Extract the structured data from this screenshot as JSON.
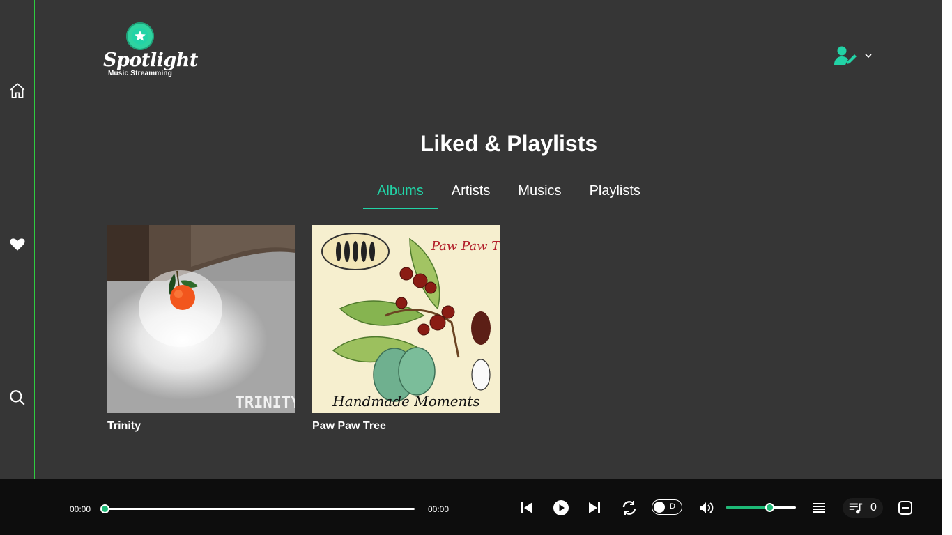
{
  "brand": {
    "name": "Spotlight",
    "tagline": "Music Streamming",
    "accent": "#22d3a6"
  },
  "sidebar": {
    "items": [
      {
        "icon": "home-icon"
      },
      {
        "icon": "heart-icon"
      },
      {
        "icon": "search-icon"
      }
    ]
  },
  "page": {
    "title": "Liked & Playlists"
  },
  "tabs": [
    {
      "label": "Albums",
      "active": true
    },
    {
      "label": "Artists",
      "active": false
    },
    {
      "label": "Musics",
      "active": false
    },
    {
      "label": "Playlists",
      "active": false
    }
  ],
  "albums": [
    {
      "name": "Trinity",
      "cover_text": "TRINITY"
    },
    {
      "name": "Paw Paw Tree",
      "cover_title": "Paw Paw Tree",
      "cover_footer": "Handmade Moments"
    }
  ],
  "player": {
    "elapsed": "00:00",
    "duration": "00:00",
    "progress": 0,
    "toggle_label": "D",
    "volume_fraction": 0.63,
    "queue_count": "0"
  }
}
